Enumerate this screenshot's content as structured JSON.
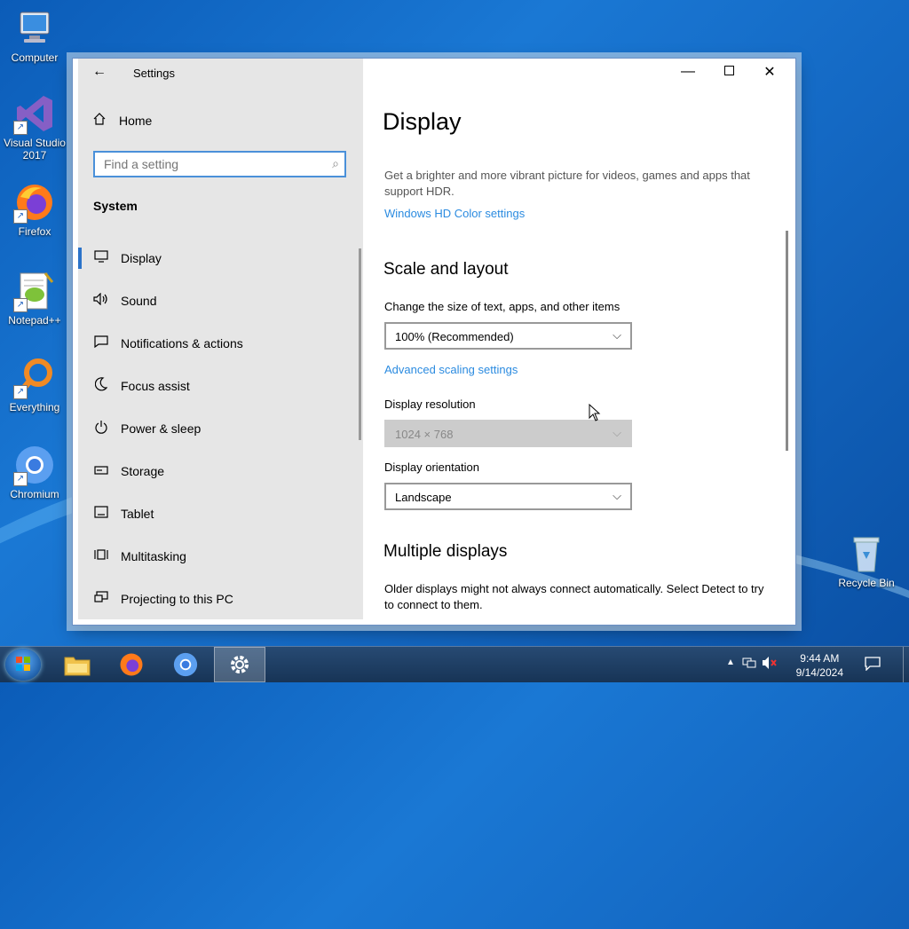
{
  "desktop": {
    "icons": [
      {
        "label": "Computer"
      },
      {
        "label": "Visual Studio 2017"
      },
      {
        "label": "Firefox"
      },
      {
        "label": "Notepad++"
      },
      {
        "label": "Everything"
      },
      {
        "label": "Chromium"
      }
    ],
    "recycle_bin": "Recycle Bin"
  },
  "window": {
    "title": "Settings",
    "sidebar": {
      "home": "Home",
      "search_placeholder": "Find a setting",
      "section": "System",
      "items": [
        {
          "label": "Display",
          "icon": "monitor-icon"
        },
        {
          "label": "Sound",
          "icon": "speaker-icon"
        },
        {
          "label": "Notifications & actions",
          "icon": "notification-icon"
        },
        {
          "label": "Focus assist",
          "icon": "moon-icon"
        },
        {
          "label": "Power & sleep",
          "icon": "power-icon"
        },
        {
          "label": "Storage",
          "icon": "storage-icon"
        },
        {
          "label": "Tablet",
          "icon": "tablet-icon"
        },
        {
          "label": "Multitasking",
          "icon": "multitasking-icon"
        },
        {
          "label": "Projecting to this PC",
          "icon": "projecting-icon"
        }
      ]
    },
    "content": {
      "title": "Display",
      "hdr_text": "Get a brighter and more vibrant picture for videos, games and apps that support HDR.",
      "hdr_link": "Windows HD Color settings",
      "scale_heading": "Scale and layout",
      "scale_label": "Change the size of text, apps, and other items",
      "scale_value": "100% (Recommended)",
      "advanced_link": "Advanced scaling settings",
      "resolution_label": "Display resolution",
      "resolution_value": "1024 × 768",
      "orientation_label": "Display orientation",
      "orientation_value": "Landscape",
      "multiple_heading": "Multiple displays",
      "multiple_text": "Older displays might not always connect automatically. Select Detect to try to connect to them."
    }
  },
  "taskbar": {
    "time": "9:44 AM",
    "date": "9/14/2024"
  },
  "colors": {
    "accent": "#2b73c9",
    "link": "#2b8be0",
    "sidebar_bg": "#e6e6e6"
  }
}
